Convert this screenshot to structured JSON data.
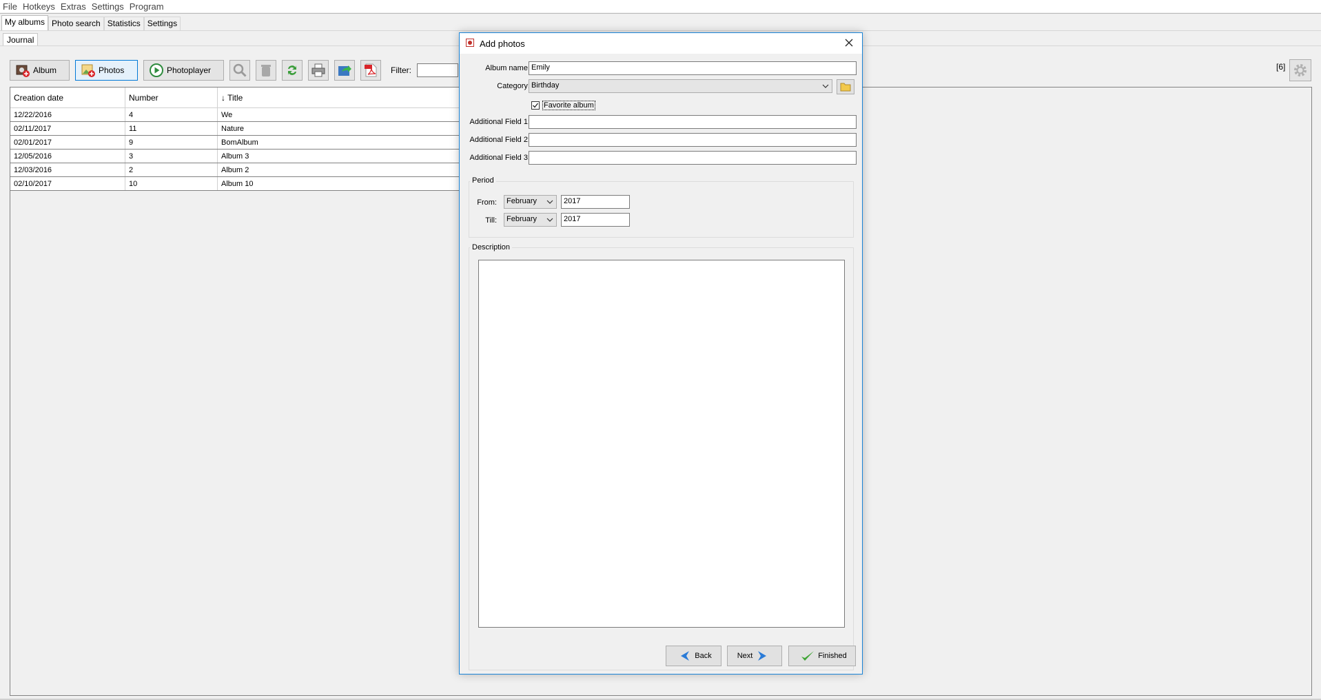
{
  "menu": [
    "File",
    "Hotkeys",
    "Extras",
    "Settings",
    "Program"
  ],
  "tabs": [
    "My albums",
    "Photo search",
    "Statistics",
    "Settings"
  ],
  "subtabs": [
    "Journal"
  ],
  "toolbar": {
    "album_label": "Album",
    "photos_label": "Photos",
    "photoplayer_label": "Photoplayer",
    "filter_label": "Filter:"
  },
  "count_badge": "[6]",
  "table": {
    "headers": [
      "Creation date",
      "Number",
      "↓ Title"
    ],
    "rows": [
      [
        "12/22/2016",
        "4",
        "We"
      ],
      [
        "02/11/2017",
        "11",
        "Nature"
      ],
      [
        "02/01/2017",
        "9",
        "BomAlbum"
      ],
      [
        "12/05/2016",
        "3",
        "Album 3"
      ],
      [
        "12/03/2016",
        "2",
        "Album 2"
      ],
      [
        "02/10/2017",
        "10",
        "Album 10"
      ]
    ]
  },
  "dialog": {
    "title": "Add photos",
    "album_name_label": "Album name:",
    "album_name_value": "Emily",
    "category_label": "Category:",
    "category_value": "Birthday",
    "favorite_label": "Favorite album",
    "field1_label": "Additional Field 1:",
    "field2_label": "Additional Field 2:",
    "field3_label": "Additional Field 3:",
    "period_title": "Period",
    "from_label": "From:",
    "from_month": "February",
    "from_year": "2017",
    "till_label": "Till:",
    "till_month": "February",
    "till_year": "2017",
    "description_title": "Description",
    "back_label": "Back",
    "next_label": "Next",
    "finished_label": "Finished"
  }
}
